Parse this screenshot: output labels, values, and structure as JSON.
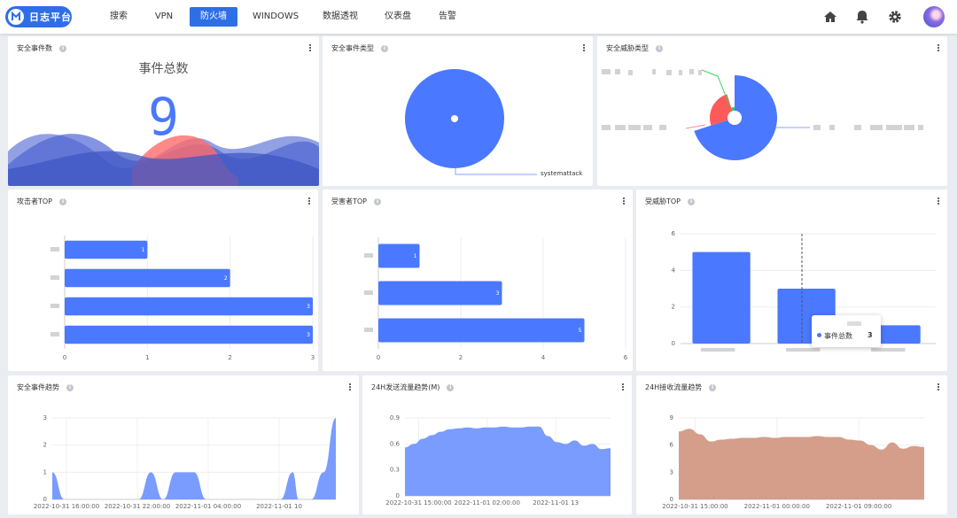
{
  "app": {
    "name": "日志平台"
  },
  "nav": {
    "tabs": [
      "搜索",
      "VPN",
      "防火墙",
      "WINDOWS",
      "数据透视",
      "仪表盘",
      "告警"
    ],
    "active_index": 2
  },
  "header_icons": [
    "home-icon",
    "bell-icon",
    "gear-icon",
    "user-avatar"
  ],
  "colors": {
    "accent": "#2f6fe6",
    "bar": "#4a78ff",
    "area_blue": "#7a9cff",
    "area_brown": "#d49e8a",
    "alert_red": "#ff5a5a",
    "green": "#3ccf5a"
  },
  "panels": {
    "event_count": {
      "title": "安全事件数",
      "headline": "事件总数",
      "value": "9"
    },
    "event_type": {
      "title": "安全事件类型",
      "slice_label": "systemattack"
    },
    "threat_type": {
      "title": "安全威胁类型"
    },
    "attacker_top": {
      "title": "攻击者TOP"
    },
    "victim_top": {
      "title": "受害者TOP"
    },
    "threatened_top": {
      "title": "受威胁TOP"
    },
    "event_trend": {
      "title": "安全事件趋势"
    },
    "send_trend": {
      "title": "24H发送流量趋势(M)"
    },
    "recv_trend": {
      "title": "24H接收流量趋势"
    }
  },
  "tooltip": {
    "series": "事件总数",
    "value": "3"
  },
  "chart_data": [
    {
      "id": "event_type",
      "type": "pie",
      "series": [
        {
          "values": [
            9
          ]
        }
      ],
      "categories": [
        "systemattack"
      ]
    },
    {
      "id": "threat_type",
      "type": "pie",
      "values": [
        70,
        25,
        5
      ],
      "colors": [
        "#4a78ff",
        "#ff5a5a",
        "#3ccf5a"
      ]
    },
    {
      "id": "attacker_top",
      "type": "bar",
      "orientation": "horizontal",
      "values": [
        1,
        2,
        3,
        3
      ],
      "xlim": [
        0,
        3
      ],
      "xticks": [
        "0",
        "1",
        "2",
        "3"
      ]
    },
    {
      "id": "victim_top",
      "type": "bar",
      "orientation": "horizontal",
      "values": [
        1,
        3,
        5
      ],
      "xlim": [
        0,
        6
      ],
      "xticks": [
        "0",
        "2",
        "4",
        "6"
      ]
    },
    {
      "id": "threatened_top",
      "type": "bar",
      "values": [
        5,
        3,
        1
      ],
      "ylim": [
        0,
        6
      ],
      "yticks": [
        "0",
        "2",
        "4",
        "6"
      ]
    },
    {
      "id": "event_trend",
      "type": "area",
      "ylim": [
        0,
        3
      ],
      "yticks": [
        "0",
        "1",
        "2",
        "3"
      ],
      "xticks": [
        "2022-10-31 16:00:00",
        "2022-10-31 22:00:00",
        "2022-11-01 04:00:00",
        "2022-11-01 10"
      ],
      "x": [
        0,
        2,
        10,
        12,
        14,
        16,
        18,
        20,
        23,
        25,
        27,
        30,
        37,
        39,
        40,
        41,
        42,
        44,
        46
      ],
      "values": [
        1,
        0,
        0,
        0,
        0,
        1,
        0,
        1,
        1,
        0,
        0,
        0,
        0,
        1,
        0,
        0,
        0,
        1,
        3
      ]
    },
    {
      "id": "send_trend",
      "type": "area",
      "ylim": [
        0,
        0.9
      ],
      "yticks": [
        "0",
        "0.3",
        "0.6",
        "0.9"
      ],
      "xticks": [
        "2022-10-31 15:00:00",
        "2022-11-01 02:00:00",
        "2022-11-01 13"
      ],
      "values": [
        0.56,
        0.6,
        0.66,
        0.7,
        0.74,
        0.77,
        0.78,
        0.79,
        0.78,
        0.79,
        0.79,
        0.8,
        0.79,
        0.79,
        0.8,
        0.8,
        0.69,
        0.62,
        0.6,
        0.64,
        0.58,
        0.6,
        0.54,
        0.55
      ]
    },
    {
      "id": "recv_trend",
      "type": "area",
      "ylim": [
        0,
        9
      ],
      "yticks": [
        "0",
        "3",
        "6",
        "9"
      ],
      "xticks": [
        "2022-10-31 15:00:00",
        "2022-11-01 00:00:00",
        "2022-11-01 09:00:00"
      ],
      "values": [
        7.5,
        7.8,
        7.2,
        6.4,
        6.6,
        6.7,
        6.8,
        6.8,
        6.9,
        6.8,
        6.9,
        6.9,
        6.9,
        7.0,
        6.9,
        6.9,
        6.6,
        6.5,
        6.0,
        5.5,
        6.3,
        5.6,
        5.9,
        5.8
      ]
    }
  ]
}
